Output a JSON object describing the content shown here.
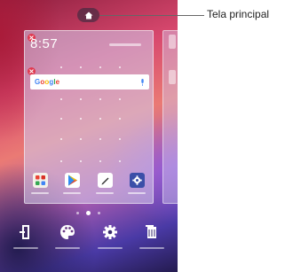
{
  "callout": {
    "label": "Tela principal"
  },
  "home_card": {
    "clock": "8:57",
    "search": {
      "logo": "Google"
    }
  },
  "dock_apps": [
    {
      "name": "apps-folder-icon"
    },
    {
      "name": "play-store-icon"
    },
    {
      "name": "pen-app-icon"
    },
    {
      "name": "settings-app-icon"
    }
  ],
  "page_indicator": {
    "count": 3,
    "active": 1
  },
  "home_options": [
    {
      "icon": "widgets-icon"
    },
    {
      "icon": "themes-palette-icon"
    },
    {
      "icon": "home-settings-gear-icon"
    },
    {
      "icon": "app-trash-icon"
    }
  ],
  "colors": {
    "badge": "#e0394f",
    "callout_line": "#666666",
    "settings_app": "#3b4fa8"
  }
}
